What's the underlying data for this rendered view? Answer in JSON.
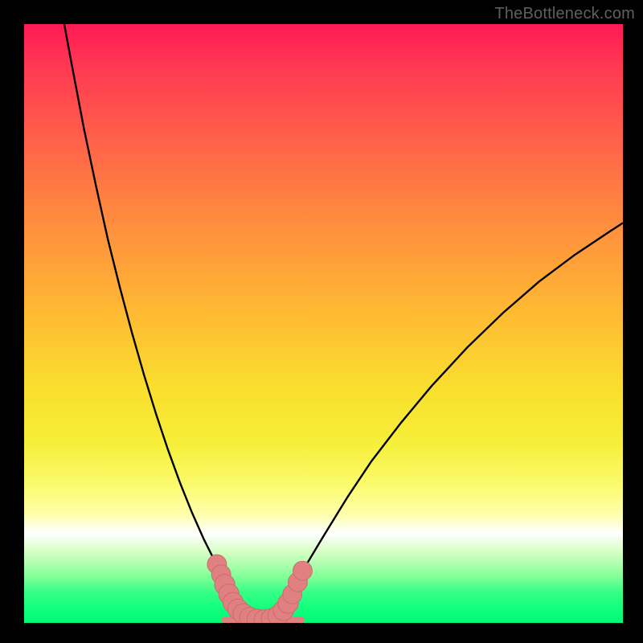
{
  "watermark": "TheBottleneck.com",
  "colors": {
    "curve_stroke": "#000000",
    "marker_fill": "#e18080",
    "marker_stroke": "#c96d6d",
    "background_top": "#ff1a55",
    "background_bottom": "#03f878",
    "frame": "#000000"
  },
  "chart_data": {
    "type": "line",
    "title": "",
    "xlabel": "",
    "ylabel": "",
    "xlim": [
      0,
      100
    ],
    "ylim": [
      0,
      100
    ],
    "grid": false,
    "legend": false,
    "series": [
      {
        "name": "left-curve",
        "x": [
          6.7,
          8,
          10,
          12,
          14,
          16,
          18,
          20,
          22,
          24,
          26,
          28,
          30,
          32,
          33.5,
          35,
          36.6
        ],
        "y": [
          100,
          93,
          82.5,
          73,
          64,
          56,
          48.5,
          41.5,
          35,
          29,
          23.5,
          18.5,
          14,
          10,
          7.3,
          5,
          3
        ]
      },
      {
        "name": "right-curve",
        "x": [
          43.1,
          44.5,
          47,
          50,
          54,
          58,
          63,
          68,
          74,
          80,
          86,
          92,
          98,
          100
        ],
        "y": [
          3,
          5.3,
          9.5,
          14.5,
          21,
          27,
          33.5,
          39.5,
          46,
          51.8,
          57,
          61.5,
          65.5,
          66.8
        ]
      },
      {
        "name": "floor-segment",
        "x": [
          33.5,
          46.3
        ],
        "y": [
          0.5,
          0.5
        ]
      }
    ],
    "markers": [
      {
        "x": 32.2,
        "y": 9.8,
        "r": 1.6
      },
      {
        "x": 32.9,
        "y": 8.1,
        "r": 1.6
      },
      {
        "x": 33.5,
        "y": 6.4,
        "r": 1.7
      },
      {
        "x": 34.2,
        "y": 4.8,
        "r": 1.7
      },
      {
        "x": 34.9,
        "y": 3.4,
        "r": 1.7
      },
      {
        "x": 35.7,
        "y": 2.3,
        "r": 1.7
      },
      {
        "x": 36.6,
        "y": 1.5,
        "r": 1.7
      },
      {
        "x": 37.7,
        "y": 0.9,
        "r": 1.7
      },
      {
        "x": 38.9,
        "y": 0.6,
        "r": 1.7
      },
      {
        "x": 40.1,
        "y": 0.5,
        "r": 1.7
      },
      {
        "x": 41.3,
        "y": 0.7,
        "r": 1.7
      },
      {
        "x": 42.4,
        "y": 1.2,
        "r": 1.7
      },
      {
        "x": 43.3,
        "y": 2.1,
        "r": 1.7
      },
      {
        "x": 44.1,
        "y": 3.3,
        "r": 1.7
      },
      {
        "x": 44.8,
        "y": 4.8,
        "r": 1.6
      },
      {
        "x": 45.7,
        "y": 6.8,
        "r": 1.6
      },
      {
        "x": 46.5,
        "y": 8.7,
        "r": 1.6
      }
    ]
  }
}
